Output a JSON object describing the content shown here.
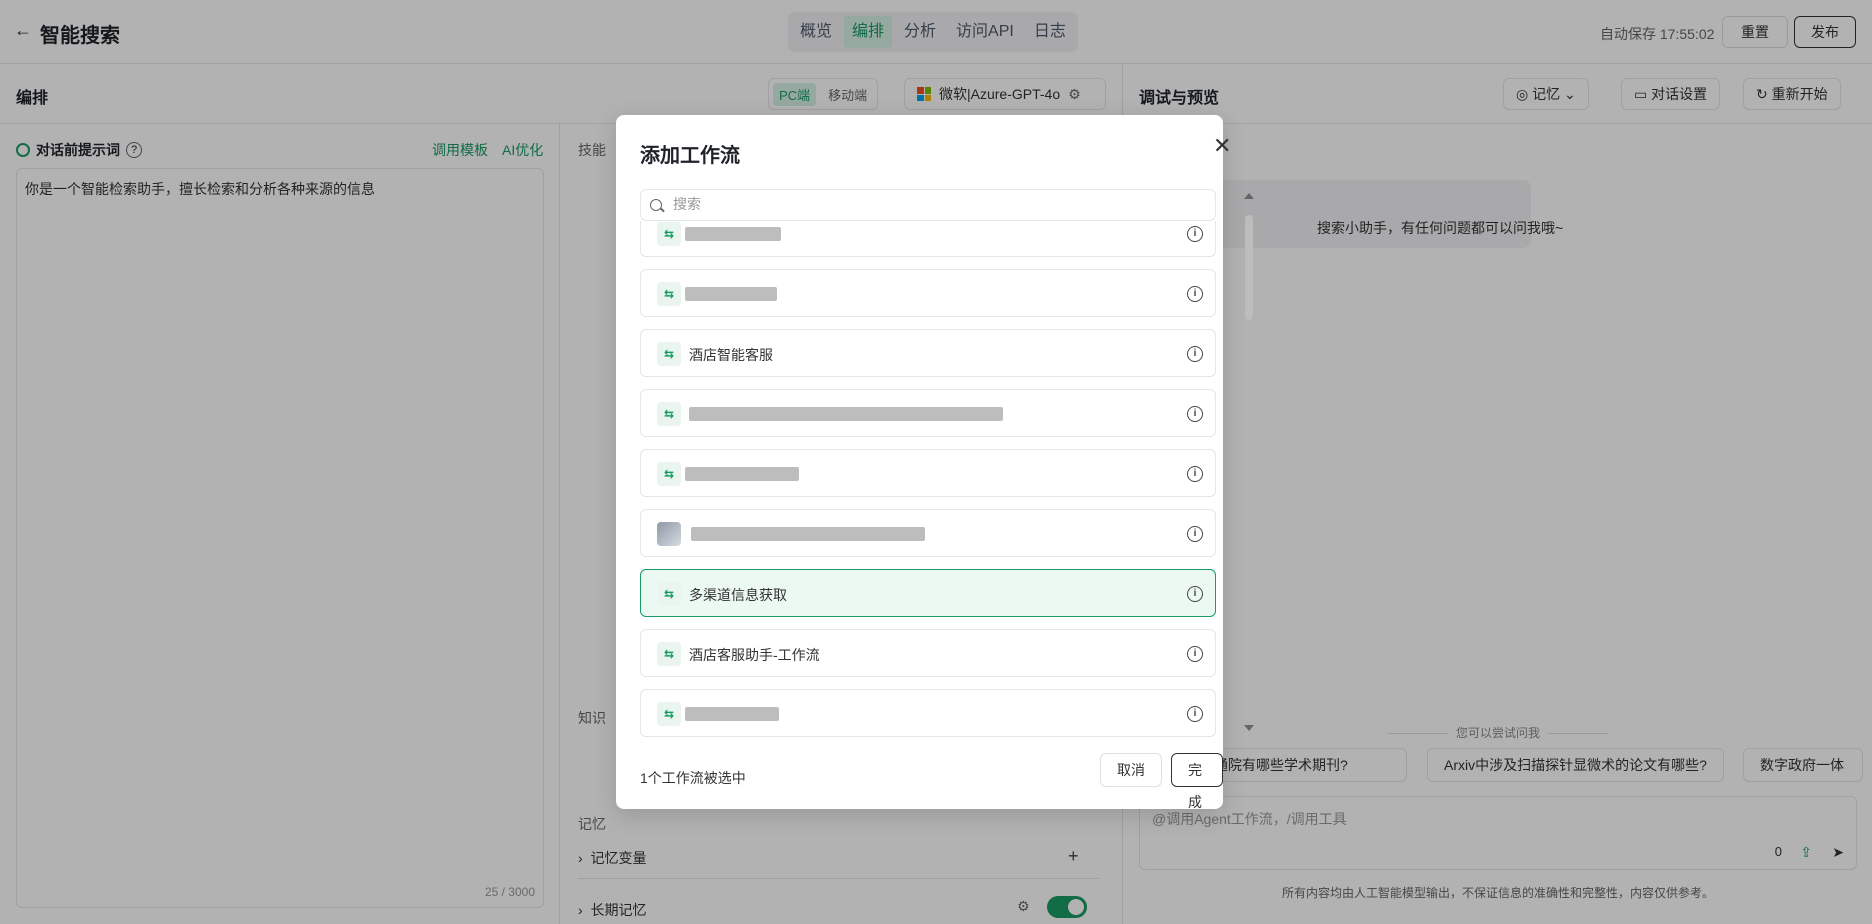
{
  "header": {
    "back_icon": "arrow-left-icon",
    "title": "智能搜索",
    "tabs": [
      "概览",
      "编排",
      "分析",
      "访问API",
      "日志"
    ],
    "active_tab": "编排",
    "autosave": "自动保存 17:55:02",
    "reset_label": "重置",
    "publish_label": "发布"
  },
  "orchestration": {
    "title": "编排",
    "platforms": [
      "PC端",
      "移动端"
    ],
    "active_platform": "PC端",
    "model": "微软|Azure-GPT-4o"
  },
  "prompt": {
    "label": "对话前提示词",
    "template_link": "调用模板",
    "ai_link": "AI优化",
    "text": "你是一个智能检索助手，擅长检索和分析各种来源的信息",
    "counter": "25 / 3000"
  },
  "skills": {
    "label": "技能",
    "knowledge_label": "知识",
    "memory_label": "记忆",
    "memory_variable": "记忆变量",
    "long_term_memory": "长期记忆"
  },
  "preview": {
    "title": "调试与预览",
    "memory_btn": "记忆",
    "settings_btn": "对话设置",
    "restart_btn": "重新开始",
    "greeting": "搜索小助手，有任何问题都可以问我哦~",
    "try_title": "您可以尝试问我",
    "chips": [
      "通院有哪些学术期刊?",
      "Arxiv中涉及扫描探针显微术的论文有哪些?",
      "数字政府一体"
    ],
    "input_placeholder": "@调用Agent工作流，/调用工具",
    "input_count": "0",
    "disclaimer": "所有内容均由人工智能模型输出，不保证信息的准确性和完整性，内容仅供参考。"
  },
  "modal": {
    "title": "添加工作流",
    "search_placeholder": "搜索",
    "items": [
      {
        "name": "",
        "redacted": true,
        "selected": false
      },
      {
        "name": "",
        "redacted": true,
        "selected": false
      },
      {
        "name": "酒店智能客服",
        "redacted": false,
        "selected": false
      },
      {
        "name": "",
        "redacted": true,
        "selected": false
      },
      {
        "name": "",
        "redacted": true,
        "selected": false
      },
      {
        "name": "",
        "redacted": true,
        "selected": false,
        "avatar": true
      },
      {
        "name": "多渠道信息获取",
        "redacted": false,
        "selected": true
      },
      {
        "name": "酒店客服助手-工作流",
        "redacted": false,
        "selected": false
      },
      {
        "name": "",
        "redacted": true,
        "selected": false
      }
    ],
    "selected_count_text": "1个工作流被选中",
    "cancel_label": "取消",
    "done_label": "完成"
  }
}
